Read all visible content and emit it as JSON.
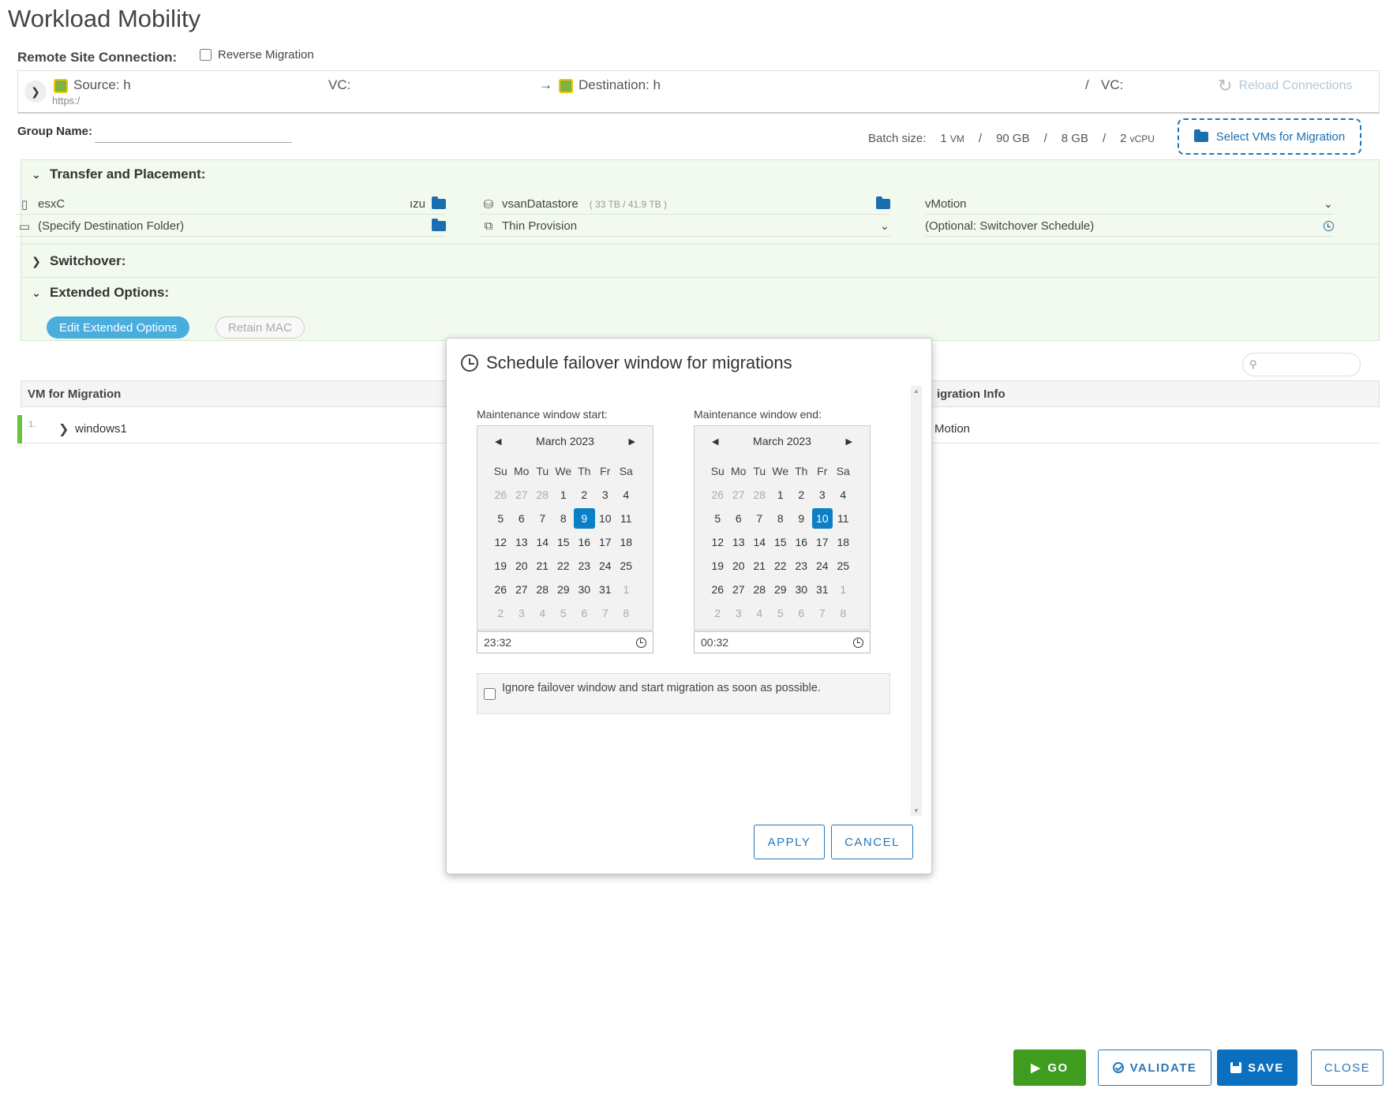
{
  "page": {
    "title": "Workload Mobility"
  },
  "remote": {
    "label": "Remote Site Connection:",
    "reverse_label": "Reverse Migration",
    "source_label": "Source: h",
    "source_url": "https:/",
    "vc_label": "VC:",
    "arrow": "→",
    "destination_label": "Destination: h",
    "dest_sep": "/",
    "vc2_label": "VC: ",
    "reload_label": "Reload Connections"
  },
  "group": {
    "label": "Group Name:",
    "value": ""
  },
  "batch": {
    "label": "Batch size:",
    "vm_count": "1",
    "vm_unit": "VM",
    "storage": "90 GB",
    "memory": "8 GB",
    "vcpu_count": "2",
    "vcpu_unit": "vCPU",
    "sep": "/"
  },
  "select_vms_label": "Select VMs for Migration",
  "transfer": {
    "header": "Transfer and Placement:",
    "host": "esxC",
    "host_suffix": "ızu",
    "folder": "(Specify Destination Folder)",
    "datastore": "vsanDatastore",
    "datastore_capacity": "( 33 TB / 41.9 TB )",
    "provisioning": "Thin Provision",
    "migration_type": "vMotion",
    "schedule": "(Optional: Switchover Schedule)"
  },
  "switchover": {
    "header": "Switchover:"
  },
  "extended": {
    "header": "Extended Options:",
    "edit_label": "Edit Extended Options",
    "retain_label": "Retain MAC"
  },
  "vm_table": {
    "col_vm": "VM for Migration",
    "col_info": "igration Info",
    "rows": [
      {
        "num": "1.",
        "name": "windows1",
        "info": "Motion"
      }
    ]
  },
  "modal": {
    "title": "Schedule failover window for migrations",
    "start_label": "Maintenance window start:",
    "end_label": "Maintenance window end:",
    "weekdays": [
      "Su",
      "Mo",
      "Tu",
      "We",
      "Th",
      "Fr",
      "Sa"
    ],
    "start": {
      "month": "March 2023",
      "time": "23:32",
      "selected_day": "9",
      "weeks": [
        [
          "26",
          "27",
          "28",
          "1",
          "2",
          "3",
          "4"
        ],
        [
          "5",
          "6",
          "7",
          "8",
          "9",
          "10",
          "11"
        ],
        [
          "12",
          "13",
          "14",
          "15",
          "16",
          "17",
          "18"
        ],
        [
          "19",
          "20",
          "21",
          "22",
          "23",
          "24",
          "25"
        ],
        [
          "26",
          "27",
          "28",
          "29",
          "30",
          "31",
          "1"
        ],
        [
          "2",
          "3",
          "4",
          "5",
          "6",
          "7",
          "8"
        ]
      ]
    },
    "end": {
      "month": "March 2023",
      "time": "00:32",
      "selected_day": "10",
      "weeks": [
        [
          "26",
          "27",
          "28",
          "1",
          "2",
          "3",
          "4"
        ],
        [
          "5",
          "6",
          "7",
          "8",
          "9",
          "10",
          "11"
        ],
        [
          "12",
          "13",
          "14",
          "15",
          "16",
          "17",
          "18"
        ],
        [
          "19",
          "20",
          "21",
          "22",
          "23",
          "24",
          "25"
        ],
        [
          "26",
          "27",
          "28",
          "29",
          "30",
          "31",
          "1"
        ],
        [
          "2",
          "3",
          "4",
          "5",
          "6",
          "7",
          "8"
        ]
      ]
    },
    "ignore_text": "Ignore failover window and start migration as soon as possible.",
    "apply_label": "APPLY",
    "cancel_label": "CANCEL"
  },
  "footer": {
    "go_label": "GO",
    "validate_label": "VALIDATE",
    "save_label": "SAVE",
    "close_label": "CLOSE"
  },
  "colors": {
    "accent_blue": "#0b80c6",
    "go_green": "#3f9c1e",
    "panel_green": "#f2f9ee",
    "row_marker": "#6ac33c"
  }
}
